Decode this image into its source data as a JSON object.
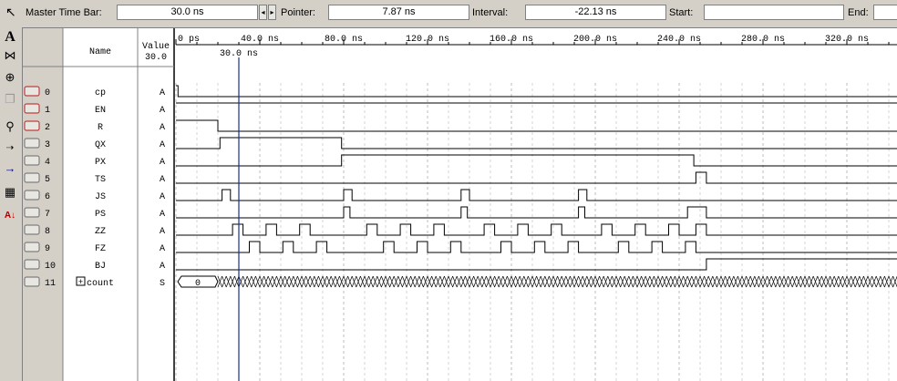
{
  "toolbar_top": {
    "master_label": "Master Time Bar:",
    "master_value": "30.0 ns",
    "pointer_label": "Pointer:",
    "pointer_value": "7.87 ns",
    "interval_label": "Interval:",
    "interval_value": "-22.13 ns",
    "start_label": "Start:",
    "start_value": "",
    "end_label": "End:",
    "end_value": ""
  },
  "tools": [
    "pointer-icon",
    "text-tool-icon",
    "waveform-edit-icon",
    "zoom-icon",
    "copy-icon",
    "find-icon",
    "replace-icon",
    "goto-icon",
    "group-icon",
    "sort-icon"
  ],
  "columns": {
    "name": "Name",
    "value": "Value",
    "value_sub": "30.0"
  },
  "timeline": {
    "ticks": [
      "0 ps",
      "40.0 ns",
      "80.0 ns",
      "120.0 ns",
      "160.0 ns",
      "200.0 ns",
      "240.0 ns",
      "280.0 ns",
      "320.0 ns"
    ],
    "cursor_label": "30.0 ns"
  },
  "signals": [
    {
      "index": "0",
      "name": "cp",
      "value": "A"
    },
    {
      "index": "1",
      "name": "EN",
      "value": "A"
    },
    {
      "index": "2",
      "name": "R",
      "value": "A"
    },
    {
      "index": "3",
      "name": "QX",
      "value": "A"
    },
    {
      "index": "4",
      "name": "PX",
      "value": "A"
    },
    {
      "index": "5",
      "name": "TS",
      "value": "A"
    },
    {
      "index": "6",
      "name": "JS",
      "value": "A"
    },
    {
      "index": "7",
      "name": "PS",
      "value": "A"
    },
    {
      "index": "8",
      "name": "ZZ",
      "value": "A"
    },
    {
      "index": "9",
      "name": "FZ",
      "value": "A"
    },
    {
      "index": "10",
      "name": "BJ",
      "value": "A"
    },
    {
      "index": "11",
      "name": "count",
      "value": "S",
      "expand": "+",
      "bus_value": "0"
    }
  ]
}
